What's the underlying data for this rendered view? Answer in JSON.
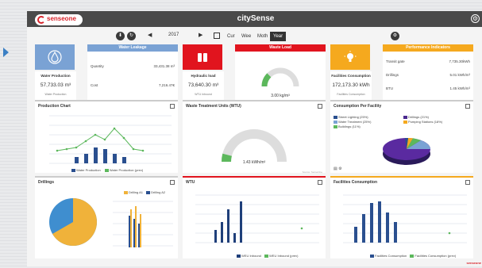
{
  "app": {
    "title": "citySense",
    "logo_text": "senseone",
    "logo_sub": "technologies"
  },
  "toolbar": {
    "year": "2017",
    "ranges": [
      "Cur",
      "Wee",
      "Moth",
      "Year"
    ],
    "active_range": "Year"
  },
  "kpis": {
    "water": {
      "head": "Water Leakage",
      "color": "#7aa2d4",
      "left_label": "Water Production",
      "left_value": "57,733.03 m³",
      "left_sub": "Water Production",
      "rows": [
        {
          "k": "Quantity",
          "v": "33,431.38 m³"
        },
        {
          "k": "Cost",
          "v": "7,216.47€"
        }
      ]
    },
    "waste": {
      "head": "Waste Load",
      "color": "#e1141e",
      "left_label": "Hydraulic load",
      "left_value": "73,640.30 m³",
      "left_sub": "WTU Inbound",
      "gauge_value": "3.00 kg/m³",
      "gauge_fraction": 0.25
    },
    "perf": {
      "head": "Performance Indicators",
      "color": "#f5a91e",
      "left_label": "Facilities Consumption",
      "left_value": "172,173.30 kWh",
      "left_sub": "Facilities Consumption",
      "rows": [
        {
          "k": "Transit gate",
          "v": "7,735.30kWh"
        },
        {
          "k": "Drillings",
          "v": "5.01 kWh/m³"
        },
        {
          "k": "BTU",
          "v": "1.45 kWh/m³"
        }
      ]
    }
  },
  "panels": {
    "production": {
      "title": "Production Chart",
      "legend": [
        "Water Production",
        "Water Production (prev)"
      ]
    },
    "wtu_top": {
      "title": "Waste Treatment Units (WTU)",
      "gauge_value": "1.43 kWh/m³",
      "gauge_fraction": 0.08,
      "footer": "Source: SenseOne"
    },
    "consumption_facility": {
      "title": "Consumption Per Facility",
      "legend": [
        "Street Lighting (25%)",
        "Drillings (21%)",
        "Water Treatment (25%)",
        "Pumping Stations (18%)",
        "Buildings (11%)"
      ]
    },
    "drillings": {
      "title": "Drillings",
      "legend": [
        "Drilling A1",
        "Drilling A2"
      ]
    },
    "wtu": {
      "title": "WTU",
      "legend": [
        "WEU Inbound",
        "WEU Inbound (prev)"
      ]
    },
    "facilities": {
      "title": "Facilities Consumption",
      "legend": [
        "Facilities Consumption",
        "Facilities Consumption (prev)"
      ]
    }
  },
  "icons": {
    "water": "water-drop-icon",
    "waste": "barrels-icon",
    "perf": "lightbulb-icon"
  },
  "footer": "senseone"
}
